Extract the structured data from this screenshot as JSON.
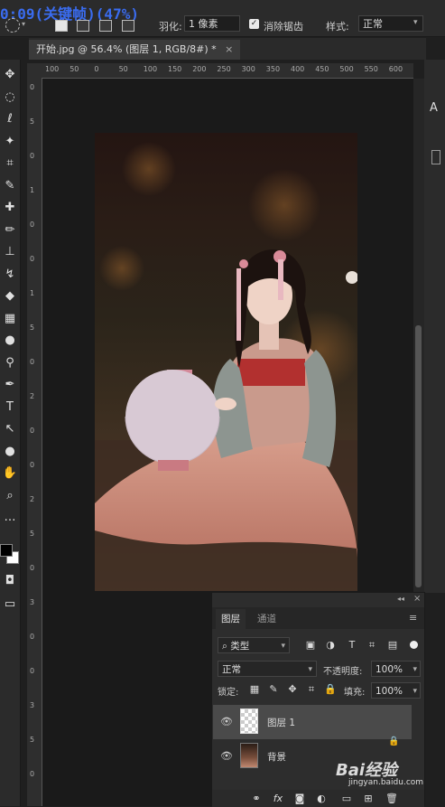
{
  "overlay": {
    "timecode": "0:09(关键帧)(47%)"
  },
  "options_bar": {
    "feather_label": "羽化:",
    "feather_value": "1 像素",
    "antialias_label": "消除锯齿",
    "style_label": "样式:",
    "style_value": "正常"
  },
  "document_tab": {
    "title": "开始.jpg @ 56.4% (图层 1, RGB/8#) *",
    "close": "×"
  },
  "ruler": {
    "top_labels": [
      "100",
      "50",
      "0",
      "50",
      "100",
      "150",
      "200",
      "250",
      "300",
      "350",
      "400",
      "450",
      "500",
      "550",
      "600"
    ],
    "left_labels": [
      "0",
      "5",
      "0",
      "1",
      "0",
      "0",
      "1",
      "5",
      "0",
      "2",
      "0",
      "0",
      "2",
      "5",
      "0",
      "3",
      "0",
      "0",
      "3",
      "5",
      "0"
    ]
  },
  "toolbar": {
    "tools": [
      "move-tool",
      "marquee-tool",
      "lasso-tool",
      "magic-wand-tool",
      "crop-tool",
      "eyedropper-tool",
      "healing-tool",
      "brush-tool",
      "stamp-tool",
      "history-brush-tool",
      "eraser-tool",
      "gradient-tool",
      "blur-tool",
      "dodge-tool",
      "pen-tool",
      "type-tool",
      "path-select-tool",
      "shape-tool",
      "hand-tool",
      "zoom-tool",
      "more-tools"
    ],
    "glyphs": [
      "✥",
      "◌",
      "ℓ",
      "✦",
      "⌗",
      "✎",
      "✚",
      "✏",
      "⊥",
      "↯",
      "◆",
      "▦",
      "●",
      "⚲",
      "✒",
      "T",
      "↖",
      "●",
      "✋",
      "⌕",
      "…"
    ],
    "foreground_color": "#000000",
    "background_color": "#ffffff"
  },
  "layers_panel": {
    "tabs": [
      "图层",
      "通道"
    ],
    "filter_kind": "类型",
    "blend_mode": "正常",
    "opacity_label": "不透明度:",
    "opacity_value": "100%",
    "lock_label": "锁定:",
    "fill_label": "填充:",
    "fill_value": "100%",
    "layers": [
      {
        "name": "图层 1",
        "selected": true
      },
      {
        "name": "背景",
        "selected": false
      }
    ],
    "footer_icons": [
      "link-icon",
      "fx-icon",
      "mask-icon",
      "adjustment-icon",
      "folder-icon",
      "new-layer-icon",
      "trash-icon"
    ]
  },
  "watermark": {
    "brand": "Bai经验",
    "url": "jingyan.baidu.com"
  },
  "colors": {
    "accent_timecode": "#3a6cf0",
    "lantern": "#d8c9d4",
    "selected_layer_bg": "#4a4a4a"
  }
}
